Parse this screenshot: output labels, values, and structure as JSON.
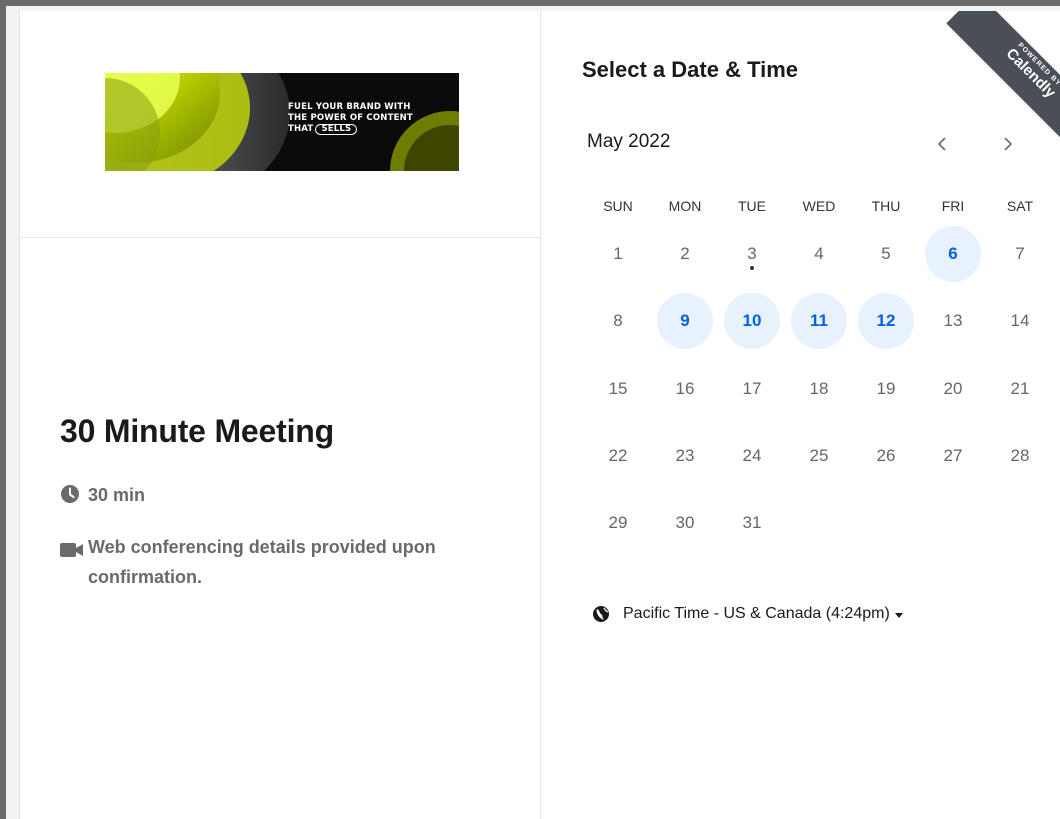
{
  "banner": {
    "line1": "FUEL YOUR BRAND WITH",
    "line2": "THE POWER OF CONTENT",
    "line3_prefix": "THAT",
    "line3_pill": "SELLS"
  },
  "event": {
    "title": "30 Minute Meeting",
    "duration": "30 min",
    "location": "Web conferencing details provided upon confirmation."
  },
  "calendar": {
    "heading": "Select a Date & Time",
    "month_label": "May 2022",
    "weekdays": [
      "SUN",
      "MON",
      "TUE",
      "WED",
      "THU",
      "FRI",
      "SAT"
    ],
    "days": [
      "1",
      "2",
      "3",
      "4",
      "5",
      "6",
      "7",
      "8",
      "9",
      "10",
      "11",
      "12",
      "13",
      "14",
      "15",
      "16",
      "17",
      "18",
      "19",
      "20",
      "21",
      "22",
      "23",
      "24",
      "25",
      "26",
      "27",
      "28",
      "29",
      "30",
      "31"
    ],
    "available_days": [
      "6",
      "9",
      "10",
      "11",
      "12"
    ],
    "today_marker_day": "3"
  },
  "timezone": {
    "label": "Pacific Time - US & Canada (4:24pm)"
  },
  "ribbon": {
    "powered_by": "POWERED BY",
    "brand": "Calendly"
  },
  "colors": {
    "accent": "#0060e6",
    "available_bg": "#e8f1fe",
    "ribbon_bg": "#4a4f57"
  }
}
